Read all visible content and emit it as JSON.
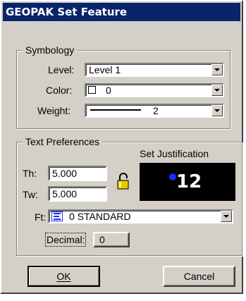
{
  "window": {
    "title": "GEOPAK Set Feature"
  },
  "symbology": {
    "legend": "Symbology",
    "level": {
      "label": "Level:",
      "value": "Level 1"
    },
    "color": {
      "label": "Color:",
      "value": "0",
      "swatch_color": "#ffffff"
    },
    "weight": {
      "label": "Weight:",
      "value": "2"
    }
  },
  "text_preferences": {
    "legend": "Text Preferences",
    "justification_label": "Set Justification",
    "justification_value": "12",
    "th": {
      "label": "Th:",
      "value": "5.000"
    },
    "tw": {
      "label": "Tw:",
      "value": "5.000"
    },
    "ft": {
      "label": "Ft:",
      "value": "0 STANDARD"
    },
    "decimal": {
      "label": "Decimal:",
      "value": "0"
    }
  },
  "buttons": {
    "ok": "OK",
    "cancel": "Cancel"
  },
  "colors": {
    "titlebar": "#0a246a",
    "dialog_bg": "#d4d0c8",
    "justification_dot": "#1a2bff"
  }
}
